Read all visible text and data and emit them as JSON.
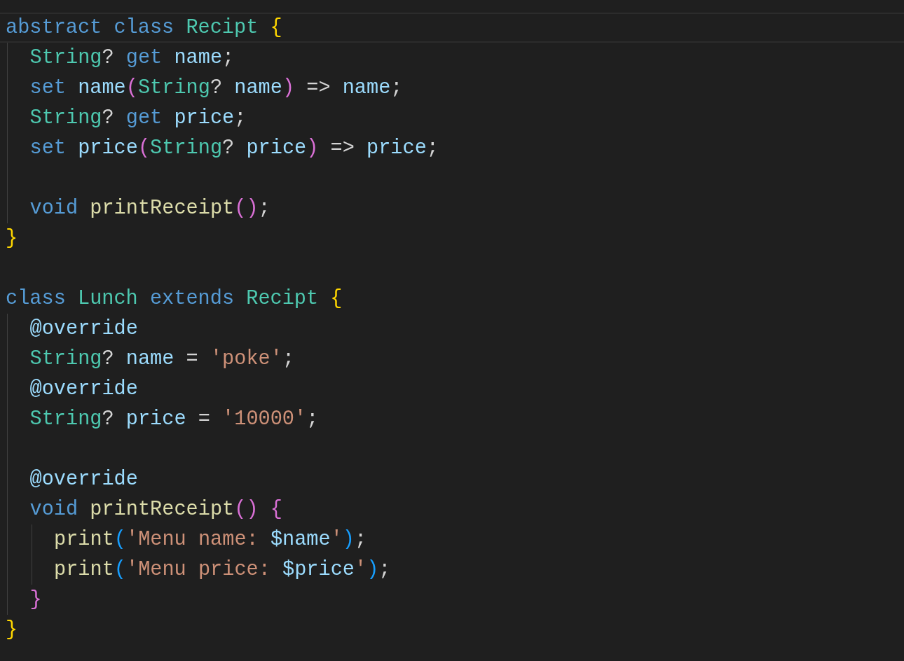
{
  "editor": {
    "lines": [
      {
        "kind": "block",
        "current": true,
        "tokens": [
          {
            "text": "abstract class ",
            "kind": "keyword"
          },
          {
            "text": "Recipt ",
            "kind": "type"
          },
          {
            "text": "{",
            "kind": "brace"
          }
        ],
        "children": [
          {
            "kind": "line",
            "current": false,
            "tokens": [
              {
                "text": "String",
                "kind": "type"
              },
              {
                "text": "? ",
                "kind": "plain"
              },
              {
                "text": "get ",
                "kind": "keyword"
              },
              {
                "text": "name",
                "kind": "variable"
              },
              {
                "text": ";",
                "kind": "plain"
              }
            ]
          },
          {
            "kind": "line",
            "current": false,
            "tokens": [
              {
                "text": "set ",
                "kind": "keyword"
              },
              {
                "text": "name",
                "kind": "variable"
              },
              {
                "text": "(",
                "kind": "paren"
              },
              {
                "text": "String",
                "kind": "type"
              },
              {
                "text": "? ",
                "kind": "plain"
              },
              {
                "text": "name",
                "kind": "variable"
              },
              {
                "text": ")",
                "kind": "paren"
              },
              {
                "text": " => ",
                "kind": "plain"
              },
              {
                "text": "name",
                "kind": "variable"
              },
              {
                "text": ";",
                "kind": "plain"
              }
            ]
          },
          {
            "kind": "line",
            "current": false,
            "tokens": [
              {
                "text": "String",
                "kind": "type"
              },
              {
                "text": "? ",
                "kind": "plain"
              },
              {
                "text": "get ",
                "kind": "keyword"
              },
              {
                "text": "price",
                "kind": "variable"
              },
              {
                "text": ";",
                "kind": "plain"
              }
            ]
          },
          {
            "kind": "line",
            "current": false,
            "tokens": [
              {
                "text": "set ",
                "kind": "keyword"
              },
              {
                "text": "price",
                "kind": "variable"
              },
              {
                "text": "(",
                "kind": "paren"
              },
              {
                "text": "String",
                "kind": "type"
              },
              {
                "text": "? ",
                "kind": "plain"
              },
              {
                "text": "price",
                "kind": "variable"
              },
              {
                "text": ")",
                "kind": "paren"
              },
              {
                "text": " => ",
                "kind": "plain"
              },
              {
                "text": "price",
                "kind": "variable"
              },
              {
                "text": ";",
                "kind": "plain"
              }
            ]
          },
          {
            "kind": "blank"
          },
          {
            "kind": "line",
            "current": false,
            "tokens": [
              {
                "text": "void ",
                "kind": "keyword"
              },
              {
                "text": "printReceipt",
                "kind": "function"
              },
              {
                "text": "()",
                "kind": "paren"
              },
              {
                "text": ";",
                "kind": "plain"
              }
            ]
          }
        ],
        "close": [
          {
            "text": "}",
            "kind": "brace"
          }
        ]
      },
      {
        "kind": "blank"
      },
      {
        "kind": "block",
        "current": false,
        "tokens": [
          {
            "text": "class ",
            "kind": "keyword"
          },
          {
            "text": "Lunch ",
            "kind": "type"
          },
          {
            "text": "extends ",
            "kind": "keyword"
          },
          {
            "text": "Recipt ",
            "kind": "type"
          },
          {
            "text": "{",
            "kind": "brace"
          }
        ],
        "children": [
          {
            "kind": "line",
            "current": false,
            "tokens": [
              {
                "text": "@override",
                "kind": "variable"
              }
            ]
          },
          {
            "kind": "line",
            "current": false,
            "tokens": [
              {
                "text": "String",
                "kind": "type"
              },
              {
                "text": "? ",
                "kind": "plain"
              },
              {
                "text": "name",
                "kind": "variable"
              },
              {
                "text": " = ",
                "kind": "plain"
              },
              {
                "text": "'poke'",
                "kind": "string"
              },
              {
                "text": ";",
                "kind": "plain"
              }
            ]
          },
          {
            "kind": "line",
            "current": false,
            "tokens": [
              {
                "text": "@override",
                "kind": "variable"
              }
            ]
          },
          {
            "kind": "line",
            "current": false,
            "tokens": [
              {
                "text": "String",
                "kind": "type"
              },
              {
                "text": "? ",
                "kind": "plain"
              },
              {
                "text": "price",
                "kind": "variable"
              },
              {
                "text": " = ",
                "kind": "plain"
              },
              {
                "text": "'10000'",
                "kind": "string"
              },
              {
                "text": ";",
                "kind": "plain"
              }
            ]
          },
          {
            "kind": "blank"
          },
          {
            "kind": "line",
            "current": false,
            "tokens": [
              {
                "text": "@override",
                "kind": "variable"
              }
            ]
          },
          {
            "kind": "block",
            "current": false,
            "tokens": [
              {
                "text": "void ",
                "kind": "keyword"
              },
              {
                "text": "printReceipt",
                "kind": "function"
              },
              {
                "text": "() ",
                "kind": "paren"
              },
              {
                "text": "{",
                "kind": "paren"
              }
            ],
            "children": [
              {
                "kind": "line",
                "current": false,
                "tokens": [
                  {
                    "text": "print",
                    "kind": "function"
                  },
                  {
                    "text": "(",
                    "kind": "bracket"
                  },
                  {
                    "text": "'Menu name: ",
                    "kind": "string"
                  },
                  {
                    "text": "$name",
                    "kind": "variable"
                  },
                  {
                    "text": "'",
                    "kind": "string"
                  },
                  {
                    "text": ")",
                    "kind": "bracket"
                  },
                  {
                    "text": ";",
                    "kind": "plain"
                  }
                ]
              },
              {
                "kind": "line",
                "current": false,
                "tokens": [
                  {
                    "text": "print",
                    "kind": "function"
                  },
                  {
                    "text": "(",
                    "kind": "bracket"
                  },
                  {
                    "text": "'Menu price: ",
                    "kind": "string"
                  },
                  {
                    "text": "$price",
                    "kind": "variable"
                  },
                  {
                    "text": "'",
                    "kind": "string"
                  },
                  {
                    "text": ")",
                    "kind": "bracket"
                  },
                  {
                    "text": ";",
                    "kind": "plain"
                  }
                ]
              }
            ],
            "close": [
              {
                "text": "}",
                "kind": "paren"
              }
            ]
          }
        ],
        "close": [
          {
            "text": "}",
            "kind": "brace"
          }
        ]
      }
    ]
  }
}
